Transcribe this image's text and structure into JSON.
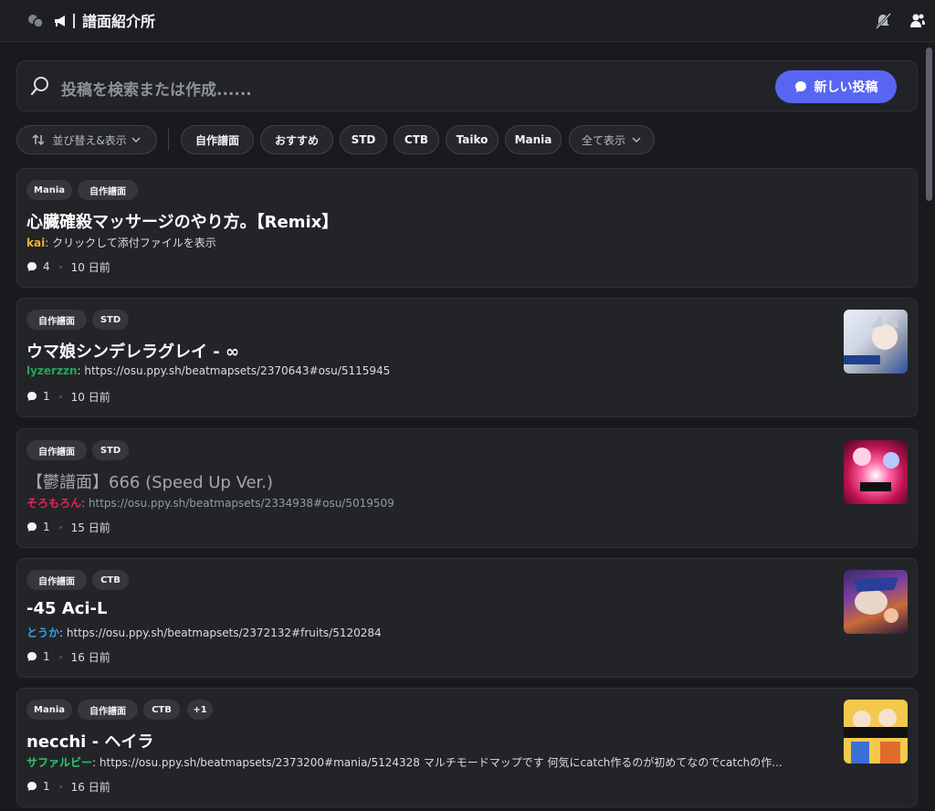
{
  "header": {
    "channel_name": "譜面紹介所",
    "icons": [
      "forum-icon",
      "announcement-icon",
      "mute-icon",
      "members-icon"
    ]
  },
  "search": {
    "placeholder": "投稿を検索または作成......",
    "new_post_label": "新しい投稿"
  },
  "filters": {
    "sort_label": "並び替え&表示",
    "chips": [
      "自作譜面",
      "おすすめ",
      "STD",
      "CTB",
      "Taiko",
      "Mania"
    ],
    "show_all_label": "全て表示"
  },
  "colors": {
    "accent": "#5865f2",
    "author_kai": "#f0b232",
    "author_lyzerzzn": "#23a55a",
    "author_soromoron": "#e0245e",
    "author_touka": "#3b9fe5",
    "author_safarubi": "#2dc770"
  },
  "posts": [
    {
      "tags": [
        "Mania",
        "自作譜面"
      ],
      "title": "心臓確殺マッサージのやり方。【Remix】",
      "author": "kai",
      "separator": ":",
      "preview": " クリックして添付ファイルを表示",
      "comments": "4",
      "age": "10 日前",
      "thumbnail": false
    },
    {
      "tags": [
        "自作譜面",
        "STD"
      ],
      "title": "ウマ娘シンデレラグレイ - ∞",
      "author": "lyzerzzn",
      "separator": ":",
      "preview": " https://osu.ppy.sh/beatmapsets/2370643#osu/5115945",
      "comments": "1",
      "age": "10 日前",
      "thumbnail": true
    },
    {
      "tags": [
        "自作譜面",
        "STD"
      ],
      "title": "【鬱譜面】666 (Speed Up Ver.)",
      "author": "そろもろん",
      "separator": ":",
      "preview": " https://osu.ppy.sh/beatmapsets/2334938#osu/5019509",
      "comments": "1",
      "age": "15 日前",
      "thumbnail": true
    },
    {
      "tags": [
        "自作譜面",
        "CTB"
      ],
      "title": "-45 Aci-L",
      "author": "とうか",
      "separator": ":",
      "preview": " https://osu.ppy.sh/beatmapsets/2372132#fruits/5120284",
      "comments": "1",
      "age": "16 日前",
      "thumbnail": true
    },
    {
      "tags": [
        "Mania",
        "自作譜面",
        "CTB",
        "+1"
      ],
      "title": "necchi - ヘイラ",
      "author": "サファルビー",
      "separator": ":",
      "preview": " https://osu.ppy.sh/beatmapsets/2373200#mania/5124328 マルチモードマップです 何気にcatch作るのが初めてなのでcatchの作...",
      "comments": "1",
      "age": "16 日前",
      "thumbnail": true
    }
  ]
}
